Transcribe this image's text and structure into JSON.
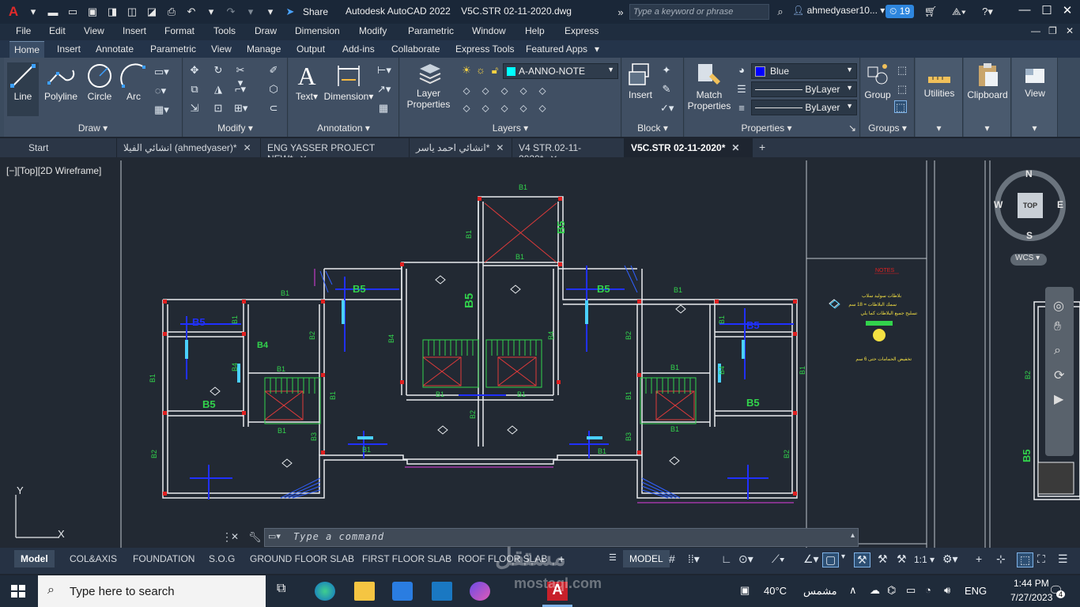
{
  "titlebar": {
    "app_title": "Autodesk AutoCAD 2022",
    "file_title": "V5C.STR 02-11-2020.dwg",
    "share_label": "Share",
    "search_placeholder": "Type a keyword or phrase",
    "user_name": "ahmedyaser10...",
    "notification_count": "19"
  },
  "menubar": {
    "items": [
      "File",
      "Edit",
      "View",
      "Insert",
      "Format",
      "Tools",
      "Draw",
      "Dimension",
      "Modify",
      "Parametric",
      "Window",
      "Help",
      "Express"
    ]
  },
  "ribbon_tabs": {
    "items": [
      "Home",
      "Insert",
      "Annotate",
      "Parametric",
      "View",
      "Manage",
      "Output",
      "Add-ins",
      "Collaborate",
      "Express Tools",
      "Featured Apps"
    ],
    "active": "Home"
  },
  "ribbon": {
    "draw": {
      "label": "Draw",
      "line": "Line",
      "polyline": "Polyline",
      "circle": "Circle",
      "arc": "Arc"
    },
    "modify": {
      "label": "Modify"
    },
    "annotation": {
      "label": "Annotation",
      "text": "Text",
      "dimension": "Dimension"
    },
    "layers": {
      "label": "Layers",
      "layer_properties": "Layer Properties",
      "current_layer": "A-ANNO-NOTE"
    },
    "block": {
      "label": "Block",
      "insert": "Insert"
    },
    "properties": {
      "label": "Properties",
      "match": "Match Properties",
      "color": "Blue",
      "linetype": "ByLayer",
      "lineweight": "ByLayer"
    },
    "groups": {
      "label": "Groups",
      "group": "Group"
    },
    "utilities": "Utilities",
    "clipboard": "Clipboard",
    "view": "View",
    "colors": {
      "color_swatch": "#0000ff",
      "layer_swatch": "#00ffff"
    }
  },
  "doc_tabs": {
    "items": [
      {
        "label": "Start",
        "closable": false
      },
      {
        "label": "انشائي الفيلا (ahmedyaser)*",
        "closable": true
      },
      {
        "label": "ENG YASSER PROJECT NEW*",
        "closable": true
      },
      {
        "label": "انشائي احمد ياسر*",
        "closable": true
      },
      {
        "label": "V4 STR.02-11-2020*",
        "closable": true
      },
      {
        "label": "V5C.STR 02-11-2020*",
        "closable": true,
        "active": true
      }
    ]
  },
  "viewport": {
    "label": "[−][Top][2D Wireframe]",
    "viewcube": {
      "north": "N",
      "south": "S",
      "east": "E",
      "west": "W",
      "face": "TOP",
      "ucs": "WCS"
    },
    "notes_title": "NOTES",
    "notes_lines": [
      "بلاطات سوليد سلاب",
      "سمك البلاطات = 18 سم",
      "تسليح جميع البلاطات كما يلي"
    ],
    "notes_footer": "تخفيض الحمامات حتى 6 سم",
    "axis_x": "X",
    "axis_y": "Y",
    "labels": {
      "b1": "B1",
      "b2": "B2",
      "b3": "B3",
      "b4": "B4",
      "b5": "B5"
    }
  },
  "command_line": {
    "placeholder": "Type a command"
  },
  "layout_tabs": [
    "Model",
    "COL&AXIS",
    "FOUNDATION",
    "S.O.G",
    "GROUND FLOOR SLAB",
    "FIRST FLOOR SLAB",
    "ROOF FLOOR SLAB"
  ],
  "statusbar": {
    "model": "MODEL",
    "scale": "1:1"
  },
  "taskbar": {
    "search_placeholder": "Type here to search",
    "weather": "40°C",
    "weather_text": "مشمس",
    "lang": "ENG",
    "time": "1:44 PM",
    "date": "7/27/2023",
    "notif_count": "4"
  },
  "watermark": {
    "brand": "مستقل",
    "url": "mostaql.com"
  }
}
